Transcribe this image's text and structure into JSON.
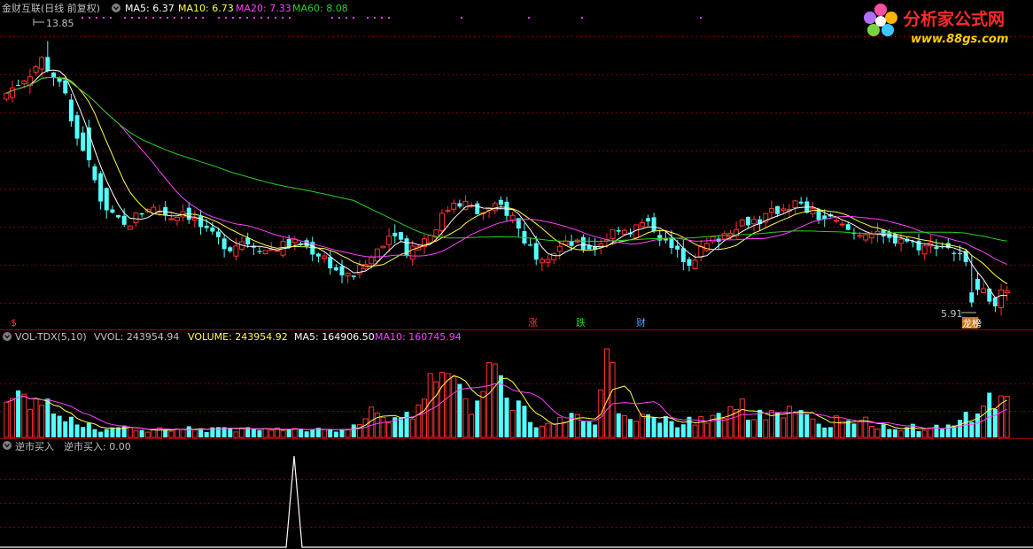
{
  "colors": {
    "background": "#000000",
    "grid": "#7a0000",
    "axis": "#9b0000",
    "up": "#ff3232",
    "down": "#54ffff",
    "ma5": "#ffffff",
    "ma10": "#ffff4e",
    "ma20": "#ff40ff",
    "ma60": "#23d223",
    "label": "#c0c0c0",
    "vol_label": "#ffff4e",
    "logo_text": "#ff2a2a",
    "logo_url": "#ffd000"
  },
  "price_panel": {
    "title": "金财互联(日线 前复权)",
    "ma5_label": "MA5: 6.37",
    "ma10_label": "MA10: 6.73",
    "ma20_label": "MA20: 7.33",
    "ma60_label": "MA60: 8.08",
    "high_label": "13.85",
    "low_label": "5.91",
    "marker_s": "$",
    "marker_zhang": "涨",
    "marker_die": "跌",
    "marker_cai": "财",
    "marker_board": "龙榜"
  },
  "volume_panel": {
    "name": "VOL-TDX(5,10)",
    "vvol": "VVOL: 243954.94",
    "volume": "VOLUME: 243954.92",
    "ma5": "MA5: 164906.50",
    "ma10": "MA10: 160745.94"
  },
  "signal_panel": {
    "name": "逆市买入",
    "value": "逆市买入: 0.00"
  },
  "logo": {
    "name": "分析家公式网",
    "url": "www.88gs.com"
  },
  "chart_data": {
    "type": "candlestick",
    "title": "金财互联(日线 前复权)",
    "ylim": [
      5.3,
      14.6
    ],
    "price_high": 13.85,
    "price_low": 5.91,
    "last_ma": {
      "MA5": 6.37,
      "MA10": 6.73,
      "MA20": 7.33,
      "MA60": 8.08
    },
    "close_path": [
      12.3,
      12.6,
      12.9,
      13.3,
      12.8,
      12.2,
      11.0,
      10.2,
      9.1,
      8.6,
      8.3,
      8.6,
      8.9,
      8.8,
      8.6,
      8.8,
      8.5,
      8.1,
      7.9,
      7.7,
      7.9,
      7.8,
      7.6,
      7.7,
      7.8,
      7.8,
      7.6,
      7.4,
      7.0,
      6.8,
      7.0,
      7.4,
      7.9,
      8.2,
      7.6,
      7.8,
      8.1,
      8.6,
      9.1,
      9.0,
      8.7,
      8.8,
      8.9,
      8.6,
      7.9,
      7.5,
      7.5,
      7.7,
      7.8,
      7.7,
      7.7,
      8.0,
      8.3,
      8.2,
      8.4,
      8.3,
      7.8,
      7.5,
      7.3,
      7.6,
      7.9,
      8.1,
      8.4,
      8.5,
      8.5,
      8.7,
      8.9,
      9.0,
      8.8,
      8.6,
      8.5,
      8.3,
      8.1,
      8.2,
      8.0,
      7.9,
      8.0,
      7.8,
      7.7,
      7.8,
      7.7,
      7.4,
      6.9,
      6.3,
      6.1,
      6.4
    ],
    "volume_path": [
      55,
      70,
      60,
      50,
      45,
      25,
      20,
      18,
      14,
      12,
      14,
      15,
      13,
      12,
      14,
      13,
      12,
      12,
      13,
      14,
      12,
      12,
      11,
      12,
      11,
      11,
      10,
      11,
      12,
      14,
      30,
      40,
      35,
      25,
      28,
      60,
      110,
      85,
      70,
      60,
      55,
      90,
      75,
      60,
      40,
      25,
      30,
      35,
      30,
      30,
      25,
      110,
      50,
      40,
      32,
      30,
      28,
      25,
      23,
      30,
      30,
      40,
      45,
      38,
      34,
      30,
      40,
      36,
      28,
      22,
      25,
      22,
      20,
      22,
      18,
      16,
      16,
      15,
      15,
      15,
      16,
      20,
      35,
      60,
      55,
      65
    ],
    "signal": {
      "spike_index": 29,
      "spike_value": 1,
      "baseline": 0
    }
  }
}
